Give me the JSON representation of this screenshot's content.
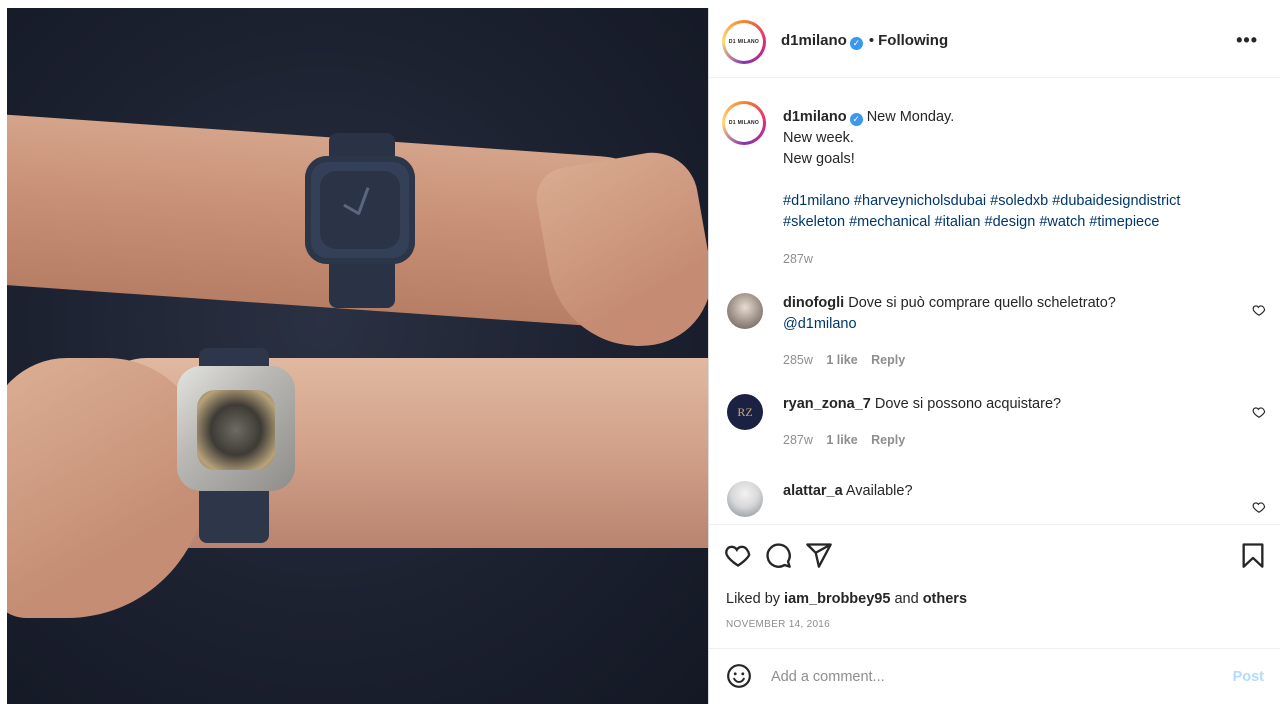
{
  "post": {
    "author": "d1milano",
    "follow_state": "Following",
    "separator": "•",
    "more": "•••",
    "avatar_text": "D1 MILANO"
  },
  "caption": {
    "username": "d1milano",
    "lines": [
      "New Monday.",
      "New week.",
      "New goals!"
    ],
    "hashtags_line1": "#d1milano #harveynicholsdubai #soledxb #dubaidesigndistrict",
    "hashtags_line2": "#skeleton #mechanical #italian #design #watch #timepiece",
    "age": "287w"
  },
  "comments": [
    {
      "username": "dinofogli",
      "text": "Dove si può comprare quello scheletrato?",
      "mention": "@d1milano",
      "age": "285w",
      "likes": "1 like",
      "reply": "Reply"
    },
    {
      "username": "ryan_zona_7",
      "text": "Dove si possono acquistare?",
      "avatar_text": "RZ",
      "age": "287w",
      "likes": "1 like",
      "reply": "Reply"
    },
    {
      "username": "alattar_a",
      "text": "Available?"
    }
  ],
  "engagement": {
    "liked_by_prefix": "Liked by",
    "liked_by_user": "iam_brobbey95",
    "and": "and",
    "others": "others",
    "date": "NOVEMBER 14, 2016"
  },
  "composer": {
    "placeholder": "Add a comment...",
    "post_label": "Post"
  },
  "colors": {
    "link": "#00376b",
    "verified": "#3897f0",
    "muted": "#8e8e8e",
    "post_disabled": "#b3dbff"
  },
  "icons": [
    "verified-badge-icon",
    "more-icon",
    "heart-icon",
    "comment-icon",
    "share-icon",
    "bookmark-icon",
    "emoji-icon"
  ]
}
